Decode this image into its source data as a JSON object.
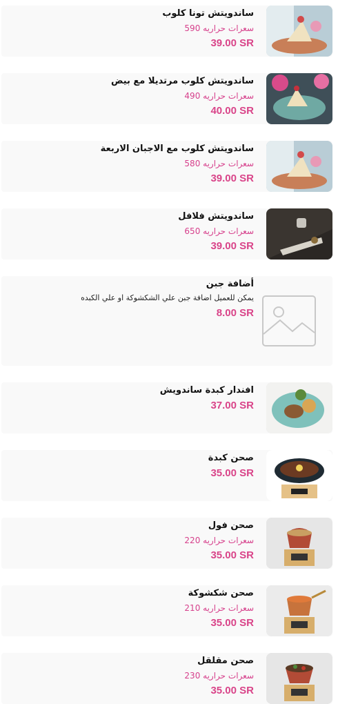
{
  "menu": {
    "items": [
      {
        "name": "ساندويتش تونا كلوب",
        "calories": "سعرات حراريه 590",
        "price": "39.00 SR"
      },
      {
        "name": "ساندويتش كلوب مرتديلا مع بيض",
        "calories": "سعرات حراريه 490",
        "price": "40.00 SR"
      },
      {
        "name": "ساندويتش كلوب مع الاجبان الاربعة",
        "calories": "سعرات حراريه 580",
        "price": "39.00 SR"
      },
      {
        "name": "ساندويتش فلافل",
        "calories": "سعرات حراريه 650",
        "price": "39.00 SR"
      },
      {
        "name": "أضافة جبن",
        "description": "يمكن للعميل اضافة جبن علي الشكشوكة او علي الكبده",
        "price": "8.00 SR"
      },
      {
        "name": "افندار كبدة ساندويش",
        "price": "37.00 SR"
      },
      {
        "name": "صحن كبدة",
        "price": "35.00 SR"
      },
      {
        "name": "صحن فول",
        "calories": "سعرات حراريه 220",
        "price": "35.00 SR"
      },
      {
        "name": "صحن شكشوكة",
        "calories": "سعرات حراريه 210",
        "price": "35.00 SR"
      },
      {
        "name": "صحن مقلقل",
        "calories": "سعرات حراريه 230",
        "price": "35.00 SR"
      }
    ]
  },
  "colors": {
    "price": "#d94489",
    "calories": "#d63f8b",
    "card_background": "#f9f9f9"
  },
  "icons": {
    "image_placeholder": "image-placeholder-icon"
  }
}
